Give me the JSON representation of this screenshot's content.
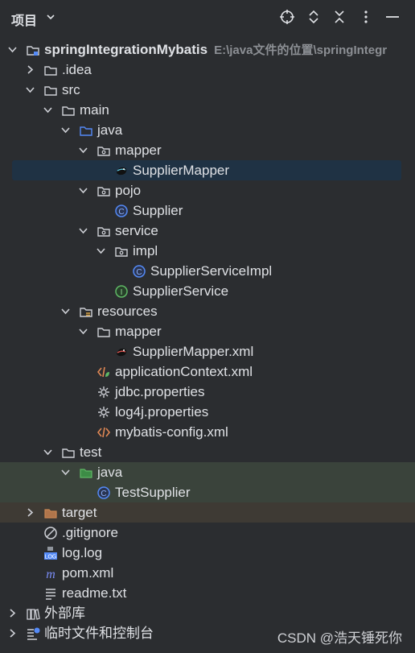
{
  "header": {
    "title": "项目",
    "icons": [
      "crosshair-icon",
      "expand-collapse-icon",
      "collapse-all-icon",
      "more-icon",
      "minimize-icon"
    ]
  },
  "tree": [
    {
      "label": "springIntegrationMybatis",
      "extra": "E:\\java文件的位置\\springIntegr",
      "icon": "module-folder-icon",
      "arrow": "down",
      "level": 0,
      "bold": true
    },
    {
      "label": ".idea",
      "icon": "folder-icon",
      "arrow": "right",
      "level": 1
    },
    {
      "label": "src",
      "icon": "folder-icon",
      "arrow": "down",
      "level": 1
    },
    {
      "label": "main",
      "icon": "folder-icon",
      "arrow": "down",
      "level": 2
    },
    {
      "label": "java",
      "icon": "source-folder-icon",
      "arrow": "down",
      "level": 3
    },
    {
      "label": "mapper",
      "icon": "package-icon",
      "arrow": "down",
      "level": 4
    },
    {
      "label": "SupplierMapper",
      "icon": "mybatis-mapper-icon",
      "arrow": "",
      "level": 5,
      "selected": true
    },
    {
      "label": "pojo",
      "icon": "package-icon",
      "arrow": "down",
      "level": 4
    },
    {
      "label": "Supplier",
      "icon": "class-icon",
      "arrow": "",
      "level": 5
    },
    {
      "label": "service",
      "icon": "package-icon",
      "arrow": "down",
      "level": 4
    },
    {
      "label": "impl",
      "icon": "package-icon",
      "arrow": "down",
      "level": 5
    },
    {
      "label": "SupplierServiceImpl",
      "icon": "class-icon",
      "arrow": "",
      "level": 6
    },
    {
      "label": "SupplierService",
      "icon": "interface-icon",
      "arrow": "",
      "level": 5
    },
    {
      "label": "resources",
      "icon": "resources-folder-icon",
      "arrow": "down",
      "level": 3
    },
    {
      "label": "mapper",
      "icon": "folder-icon",
      "arrow": "down",
      "level": 4
    },
    {
      "label": "SupplierMapper.xml",
      "icon": "mybatis-xml-icon",
      "arrow": "",
      "level": 5
    },
    {
      "label": "applicationContext.xml",
      "icon": "spring-xml-icon",
      "arrow": "",
      "level": 4
    },
    {
      "label": "jdbc.properties",
      "icon": "properties-icon",
      "arrow": "",
      "level": 4
    },
    {
      "label": "log4j.properties",
      "icon": "properties-icon",
      "arrow": "",
      "level": 4
    },
    {
      "label": "mybatis-config.xml",
      "icon": "xml-icon",
      "arrow": "",
      "level": 4
    },
    {
      "label": "test",
      "icon": "folder-icon",
      "arrow": "down",
      "level": 2
    },
    {
      "label": "java",
      "icon": "test-source-folder-icon",
      "arrow": "down",
      "level": 3,
      "bg": "test"
    },
    {
      "label": "TestSupplier",
      "icon": "class-icon",
      "arrow": "",
      "level": 4,
      "bg": "test"
    },
    {
      "label": "target",
      "icon": "excluded-folder-icon",
      "arrow": "right",
      "level": 1,
      "bg": "target"
    },
    {
      "label": ".gitignore",
      "icon": "gitignore-icon",
      "arrow": "",
      "level": 1
    },
    {
      "label": "log.log",
      "icon": "log-file-icon",
      "arrow": "",
      "level": 1
    },
    {
      "label": "pom.xml",
      "icon": "maven-icon",
      "arrow": "",
      "level": 1
    },
    {
      "label": "readme.txt",
      "icon": "text-file-icon",
      "arrow": "",
      "level": 1
    },
    {
      "label": "外部库",
      "icon": "library-icon",
      "arrow": "right",
      "level": 0
    },
    {
      "label": "临时文件和控制台",
      "icon": "scratches-icon",
      "arrow": "right",
      "level": 0
    }
  ],
  "watermark": "CSDN @浩天锤死你",
  "colors": {
    "background": "#2b2d30",
    "selected_row": "#1f3244",
    "test_row": "#3a433b",
    "target_row": "#3e3a34",
    "class_icon": "#548af7",
    "interface_icon": "#5fb865"
  }
}
